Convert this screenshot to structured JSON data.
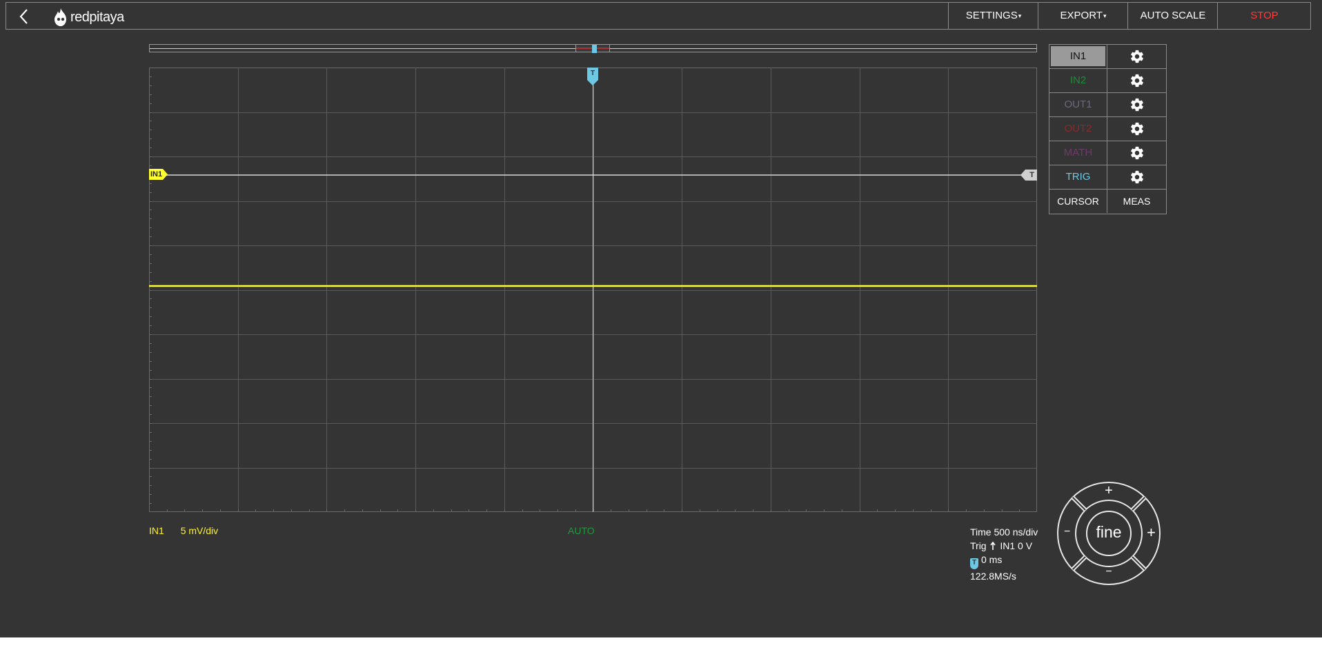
{
  "header": {
    "back_icon": "chevron-left-icon",
    "logo_text": "redpitaya",
    "menu": [
      {
        "label": "SETTINGS",
        "caret": "▾",
        "color": "#ffffff"
      },
      {
        "label": "EXPORT",
        "caret": "▾",
        "color": "#ffffff"
      },
      {
        "label": "AUTO SCALE",
        "caret": "",
        "color": "#ffffff"
      },
      {
        "label": "STOP",
        "caret": "",
        "color": "#ff3b3b"
      }
    ]
  },
  "graph": {
    "background": "#343434",
    "grid_color": "#5a5a5a",
    "trace_color": "#ffff30",
    "trigger_line_color": "#d8d8d8",
    "in1_marker_label": "IN1",
    "trigger_level_label": "T",
    "trigger_time_label": "T"
  },
  "channels": [
    {
      "label": "IN1",
      "color": "#111111",
      "background": "#9a9a9a",
      "gear_icon": "gear-icon"
    },
    {
      "label": "IN2",
      "color": "#1f8a3a",
      "background": "transparent",
      "gear_icon": "gear-icon"
    },
    {
      "label": "OUT1",
      "color": "#6a6a7e",
      "background": "transparent",
      "gear_icon": "gear-icon"
    },
    {
      "label": "OUT2",
      "color": "#8a2a2a",
      "background": "transparent",
      "gear_icon": "gear-icon"
    },
    {
      "label": "MATH",
      "color": "#6e3a6a",
      "background": "transparent",
      "gear_icon": "gear-icon"
    },
    {
      "label": "TRIG",
      "color": "#6fc8e3",
      "background": "transparent",
      "gear_icon": "gear-icon"
    }
  ],
  "tools": {
    "cursor": "CURSOR",
    "meas": "MEAS"
  },
  "info": {
    "channel": "IN1",
    "scale": "5 mV/div",
    "trigger_mode": "AUTO",
    "time_scale": "Time 500 ns/div",
    "trig_prefix": "Trig",
    "trig_edge_icon": "arrow-up-icon",
    "trig_source": "IN1 0 V",
    "offset_badge": "T",
    "offset": "0 ms",
    "sample_rate": "122.8MS/s"
  },
  "wheel": {
    "center": "fine",
    "up": "+",
    "down": "−",
    "left": "−",
    "right": "+"
  }
}
